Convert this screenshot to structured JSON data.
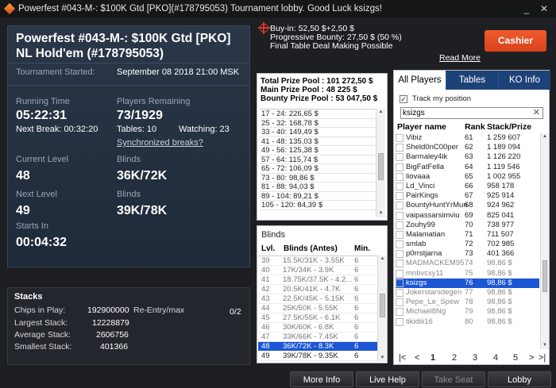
{
  "window": {
    "title": "Powerfest #043-M-: $100K Gtd [PKO](#178795053) Tournament lobby. Good Luck ksizgs!",
    "minimize": "_",
    "close": "✕"
  },
  "tournament": {
    "name": "Powerfest #043-M-: $100K Gtd [PKO] NL Hold'em (#178795053)",
    "started_label": "Tournament Started:",
    "started_value": "September 08 2018  21:00 MSK",
    "running_time_label": "Running Time",
    "running_time": "05:22:31",
    "next_break": "Next Break: 00:32:20",
    "players_remaining_label": "Players Remaining",
    "players_remaining": "73/1929",
    "tables": "Tables: 10",
    "watching": "Watching: 23",
    "sync_breaks": "Synchronized breaks?",
    "current_level_label": "Current Level",
    "current_level": "48",
    "blinds_label": "Blinds",
    "current_blinds": "36K/72K",
    "next_level_label": "Next Level",
    "next_level": "49",
    "next_blinds_label": "Blinds",
    "next_blinds": "39K/78K",
    "starts_in_label": "Starts In",
    "starts_in": "00:04:32"
  },
  "stacks": {
    "title": "Stacks",
    "chips_label": "Chips in Play:",
    "chips": "192900000",
    "reentry_label": "Re-Entry/max",
    "reentry": "0/2",
    "largest_label": "Largest Stack:",
    "largest": "12228879",
    "average_label": "Average Stack:",
    "average": "2606756",
    "smallest_label": "Smallest Stack:",
    "smallest": "401366"
  },
  "info": {
    "buyin": "Buy-in: 52,50 $+2,50 $",
    "bounty": "Progressive Bounty: 27,50 $ (50 %)",
    "deal": "Final Table Deal Making Possible",
    "read_more": "Read More",
    "cashier": "Cashier"
  },
  "prize": {
    "total": "Total Prize Pool : 101 272,50 $",
    "main": "Main Prize Pool : 48 225 $",
    "bounty": "Bounty Prize Pool : 53 047,50 $",
    "rows": [
      "17 - 24: 226,65 $",
      "25 - 32: 168,78 $",
      "33 - 40: 149,49 $",
      "41 - 48: 135,03 $",
      "49 - 56: 125,38 $",
      "57 - 64: 115,74 $",
      "65 - 72: 106,09 $",
      "73 - 80: 98,86 $",
      "81 - 88: 94,03 $",
      "89 - 104: 89,21 $",
      "105 - 120: 84,39 $"
    ]
  },
  "blinds": {
    "title": "Blinds",
    "col_lvl": "Lvl.",
    "col_blinds": "Blinds (Antes)",
    "col_min": "Min.",
    "rows": [
      {
        "lvl": "39",
        "b": "15.5K/31K - 3.55K",
        "m": "6"
      },
      {
        "lvl": "40",
        "b": "17K/34K - 3.9K",
        "m": "6"
      },
      {
        "lvl": "41",
        "b": "18.75K/37.5K - 4.2...",
        "m": "6"
      },
      {
        "lvl": "42",
        "b": "20.5K/41K - 4.7K",
        "m": "6"
      },
      {
        "lvl": "43",
        "b": "22.5K/45K - 5.15K",
        "m": "6"
      },
      {
        "lvl": "44",
        "b": "25K/50K - 5.55K",
        "m": "6"
      },
      {
        "lvl": "45",
        "b": "27.5K/55K - 6.1K",
        "m": "6"
      },
      {
        "lvl": "46",
        "b": "30K/60K - 6.8K",
        "m": "6"
      },
      {
        "lvl": "47",
        "b": "33K/66K - 7.45K",
        "m": "6"
      },
      {
        "lvl": "48",
        "b": "36K/72K - 8.3K",
        "m": "6"
      },
      {
        "lvl": "49",
        "b": "39K/78K - 9.35K",
        "m": "6"
      }
    ]
  },
  "players": {
    "tabs": [
      "All Players",
      "Tables",
      "KO Info"
    ],
    "track_label": "Track my position",
    "search_value": "ksizgs",
    "search_clear": "✕",
    "col_name": "Player name",
    "col_rank": "Rank",
    "col_stack": "Stack/Prize",
    "rows": [
      {
        "n": "Vibiz",
        "r": "61",
        "s": "1 259 607"
      },
      {
        "n": "Sheld0nC00per",
        "r": "62",
        "s": "1 189 094"
      },
      {
        "n": "Barmaley4ik",
        "r": "63",
        "s": "1 126 220"
      },
      {
        "n": "BigFatFella",
        "r": "64",
        "s": "1 119 546"
      },
      {
        "n": "liovaaa",
        "r": "65",
        "s": "1 002 955"
      },
      {
        "n": "Ld_Vinci",
        "r": "66",
        "s": "958 178"
      },
      {
        "n": "PairKings",
        "r": "67",
        "s": "925 914"
      },
      {
        "n": "BountyHuntYrMun",
        "r": "68",
        "s": "924 962"
      },
      {
        "n": "vaipassarsimviu",
        "r": "69",
        "s": "825 041"
      },
      {
        "n": "Zouhy99",
        "r": "70",
        "s": "738 977"
      },
      {
        "n": "Malamatian",
        "r": "71",
        "s": "711 507"
      },
      {
        "n": "smlab",
        "r": "72",
        "s": "702 985"
      },
      {
        "n": "p0rrstjarna",
        "r": "73",
        "s": "401 366"
      },
      {
        "n": "MADMACKEM95",
        "r": "74",
        "s": "98,86 $"
      },
      {
        "n": "mnbvcxy11",
        "r": "75",
        "s": "98,86 $"
      },
      {
        "n": "ksizgs",
        "r": "76",
        "s": "98,86 $"
      },
      {
        "n": "Jokerstarsdegen",
        "r": "77",
        "s": "98,86 $"
      },
      {
        "n": "Pepe_Le_Spew",
        "r": "78",
        "s": "98,86 $"
      },
      {
        "n": "Michael8Ng",
        "r": "79",
        "s": "98,86 $"
      },
      {
        "n": "tikidiii16",
        "r": "80",
        "s": "98,86 $"
      }
    ],
    "pages": [
      "1",
      "2",
      "3",
      "4",
      "5"
    ]
  },
  "buttons": {
    "more_info": "More Info",
    "live_help": "Live Help",
    "take_seat": "Take Seat",
    "lobby": "Lobby"
  }
}
